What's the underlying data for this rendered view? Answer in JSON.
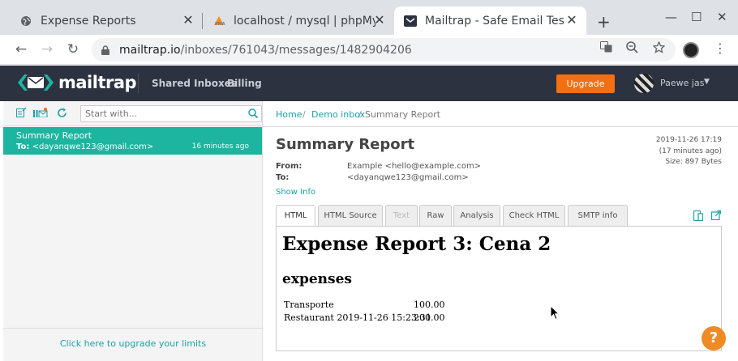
{
  "browser": {
    "tabs": [
      {
        "title": "Expense Reports"
      },
      {
        "title": "localhost / mysql | phpMyA"
      },
      {
        "title": "Mailtrap - Safe Email Testi"
      }
    ],
    "url_host": "mailtrap.io",
    "url_path": "/inboxes/761043/messages/1482904206"
  },
  "header": {
    "logo_text": "mailtrap",
    "nav": [
      "Shared Inboxes",
      "Billing"
    ],
    "upgrade_label": "Upgrade",
    "user_name": "Paewe jas"
  },
  "sidebar": {
    "search_placeholder": "Start with...",
    "messages": [
      {
        "subject": "Summary Report",
        "to_label": "To:",
        "to": "<dayanqwe123@gmail.com>",
        "time": "16 minutes ago"
      }
    ],
    "upgrade_link": "Click here to upgrade your limits"
  },
  "breadcrumb": {
    "home": "Home",
    "inbox": "Demo inbox",
    "current": "Summary Report"
  },
  "message": {
    "subject": "Summary Report",
    "date": "2019-11-26 17:19",
    "ago": "(17 minutes ago)",
    "size": "Size: 897 Bytes",
    "from_label": "From:",
    "from": "Example <hello@example.com>",
    "to_label": "To:",
    "to": "<dayanqwe123@gmail.com>",
    "show_info": "Show Info"
  },
  "view_tabs": [
    "HTML",
    "HTML Source",
    "Text",
    "Raw",
    "Analysis",
    "Check HTML",
    "SMTP info"
  ],
  "preview": {
    "heading": "Expense Report 3: Cena 2",
    "subheading": "expenses",
    "rows": [
      {
        "label": "Transporte",
        "amount": "100.00"
      },
      {
        "label": "Restaurant 2019-11-26 15:23:31",
        "amount": "200.00"
      }
    ]
  },
  "help_label": "?",
  "colors": {
    "teal": "#1db4a0",
    "header_bg": "#2d3240",
    "upgrade_orange": "#f46f10"
  }
}
